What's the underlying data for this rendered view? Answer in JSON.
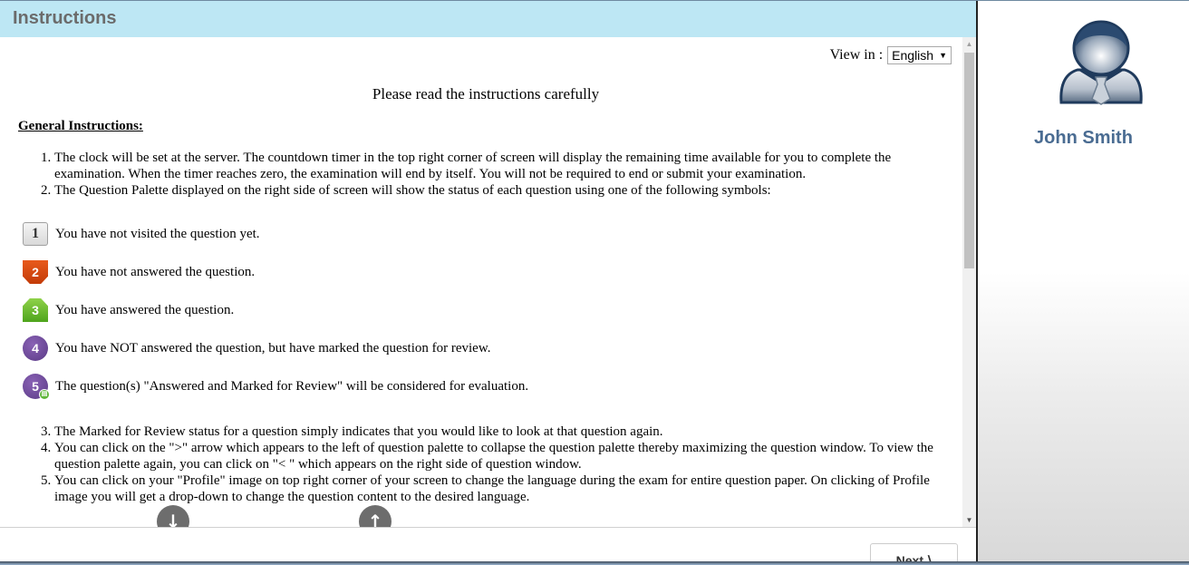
{
  "header": {
    "title": "Instructions"
  },
  "language": {
    "label": "View in :",
    "selected": "English"
  },
  "headline": "Please read the instructions carefully",
  "general_title": "General Instructions:",
  "instructions_a": [
    "The clock will be set at the server. The countdown timer in the top right corner of screen will display the remaining time available for you to complete the examination. When the timer reaches zero, the examination will end by itself. You will not be required to end or submit your examination.",
    "The Question Palette displayed on the right side of screen will show the status of each question using one of the following symbols:"
  ],
  "legend": [
    {
      "number": "1",
      "status": "not-visited",
      "text": "You have not visited the question yet."
    },
    {
      "number": "2",
      "status": "not-answered",
      "text": "You have not answered the question."
    },
    {
      "number": "3",
      "status": "answered",
      "text": "You have answered the question."
    },
    {
      "number": "4",
      "status": "marked-for-review",
      "text": "You have NOT answered the question, but have marked the question for review."
    },
    {
      "number": "5",
      "status": "answered-and-marked",
      "text": "The question(s) \"Answered and Marked for Review\" will be considered for evaluation."
    }
  ],
  "instructions_b": [
    "The Marked for Review status for a question simply indicates that you would like to look at that question again.",
    "You can click on the \">\" arrow which appears to the left of question palette to collapse the question palette thereby maximizing the question window. To view the question palette again, you can click on \"< \" which appears on the right side of question window.",
    "You can click on your \"Profile\" image on top right corner of your screen to change the language during the exam for entire question paper. On clicking of Profile image you will get a drop-down to change the question content to the desired language."
  ],
  "scroll_buttons": {
    "down_icon": "arrow-down-circle-icon",
    "up_icon": "arrow-up-circle-icon"
  },
  "footer": {
    "next_label": "Next ⟩"
  },
  "profile": {
    "name": "John Smith",
    "avatar_icon": "user-avatar-icon"
  },
  "colors": {
    "header_bg": "#bde7f4",
    "not_answered": "#d94a12",
    "answered": "#6cc030",
    "marked": "#6a4a9a",
    "profile_name": "#4a6c92"
  }
}
